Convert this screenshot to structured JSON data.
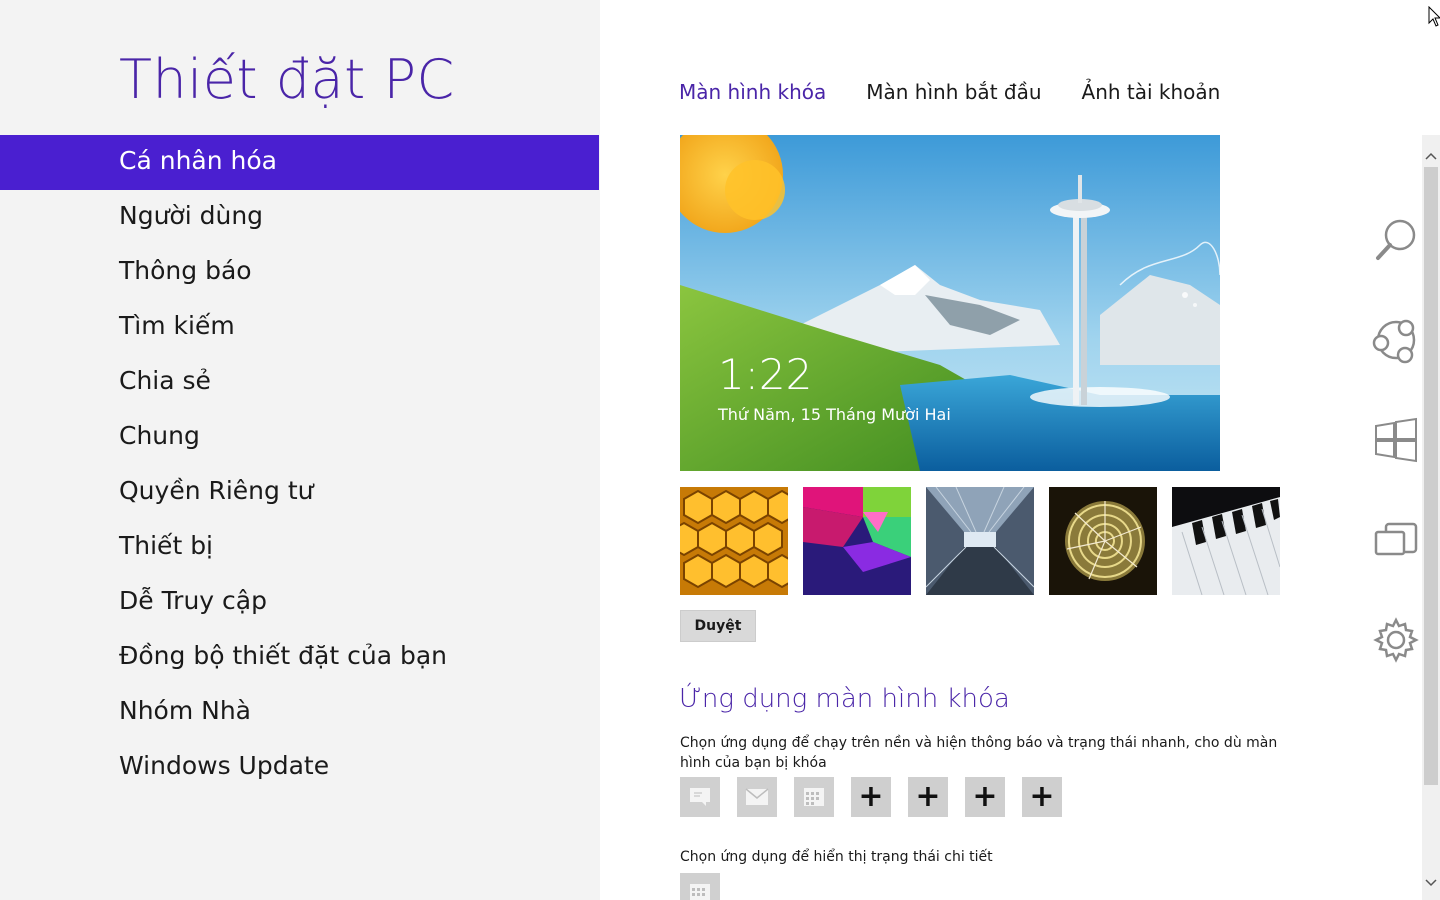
{
  "sidebar": {
    "title": "Thiết đặt PC",
    "items": [
      {
        "label": "Cá nhân hóa",
        "selected": true
      },
      {
        "label": "Người dùng"
      },
      {
        "label": "Thông báo"
      },
      {
        "label": "Tìm kiếm"
      },
      {
        "label": "Chia sẻ"
      },
      {
        "label": "Chung"
      },
      {
        "label": "Quyền Riêng tư"
      },
      {
        "label": "Thiết bị"
      },
      {
        "label": "Dễ Truy cập"
      },
      {
        "label": "Đồng bộ thiết đặt của bạn"
      },
      {
        "label": "Nhóm Nhà"
      },
      {
        "label": "Windows Update"
      }
    ]
  },
  "tabs": [
    {
      "label": "Màn hình khóa",
      "active": true
    },
    {
      "label": "Màn hình bắt đầu"
    },
    {
      "label": "Ảnh tài khoản"
    }
  ],
  "lock_preview": {
    "time": "1:22",
    "date": "Thứ Năm, 15 Tháng Mười Hai"
  },
  "browse_button": "Duyệt",
  "lock_apps": {
    "title": "Ứng dụng màn hình khóa",
    "description": "Chọn ứng dụng để chạy trên nền và hiện thông báo và trạng thái nhanh, cho dù màn hình của bạn bị khóa",
    "plus": "+",
    "detail_description": "Chọn ứng dụng để hiển thị trạng thái chi tiết"
  },
  "colors": {
    "accent": "#4a25a8",
    "selected_bg": "#4a1fd0",
    "sidebar_bg": "#f3f3f3"
  }
}
